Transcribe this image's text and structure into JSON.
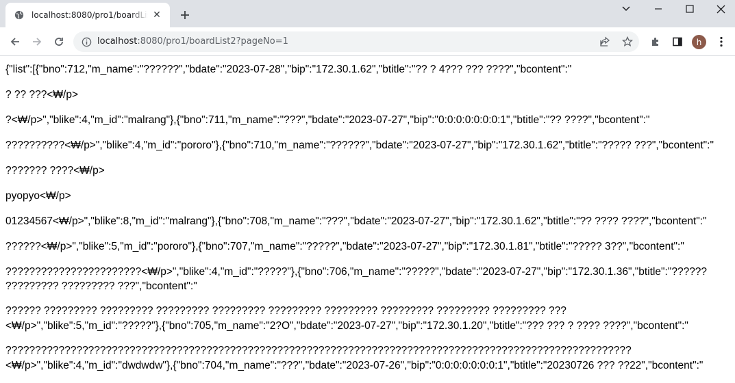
{
  "tab": {
    "title": "localhost:8080/pro1/boardList2?pageNo=1"
  },
  "address_bar": {
    "host": "localhost",
    "rest": ":8080/pro1/boardList2?pageNo=1"
  },
  "profile": {
    "initial": "h"
  },
  "content": {
    "lines": [
      "{\"list\":[{\"bno\":712,\"m_name\":\"??????\",\"bdate\":\"2023-07-28\",\"bip\":\"172.30.1.62\",\"btitle\":\"?? ? 4??? ??? ????\",\"bcontent\":\"",
      "? ?? ???<₩/p>",
      "?<₩/p>\",\"blike\":4,\"m_id\":\"malrang\"},{\"bno\":711,\"m_name\":\"???\",\"bdate\":\"2023-07-27\",\"bip\":\"0:0:0:0:0:0:0:1\",\"btitle\":\"?? ????\",\"bcontent\":\"",
      "??????????<₩/p>\",\"blike\":4,\"m_id\":\"pororo\"},{\"bno\":710,\"m_name\":\"??????\",\"bdate\":\"2023-07-27\",\"bip\":\"172.30.1.62\",\"btitle\":\"????? ???\",\"bcontent\":\"",
      "??????? ????<₩/p>",
      "pyopyo<₩/p>",
      "01234567<₩/p>\",\"blike\":8,\"m_id\":\"malrang\"},{\"bno\":708,\"m_name\":\"???\",\"bdate\":\"2023-07-27\",\"bip\":\"172.30.1.62\",\"btitle\":\"?? ???? ????\",\"bcontent\":\"",
      "??????<₩/p>\",\"blike\":5,\"m_id\":\"pororo\"},{\"bno\":707,\"m_name\":\"?????\",\"bdate\":\"2023-07-27\",\"bip\":\"172.30.1.81\",\"btitle\":\"????? 3??\",\"bcontent\":\"",
      "???????????????????????<₩/p>\",\"blike\":4,\"m_id\":\"?????\"},{\"bno\":706,\"m_name\":\"?????\",\"bdate\":\"2023-07-27\",\"bip\":\"172.30.1.36\",\"btitle\":\"??????",
      "????????? ????????? ???\",\"bcontent\":\"",
      "?????? ????????? ????????? ????????? ????????? ????????? ????????? ????????? ????????? ????????? ???",
      "<₩/p>\",\"blike\":5,\"m_id\":\"?????\"},{\"bno\":705,\"m_name\":\"2?O\",\"bdate\":\"2023-07-27\",\"bip\":\"172.30.1.20\",\"btitle\":\"??? ??? ? ???? ????\",\"bcontent\":\"",
      "??????????????????????????????????????????????????????????????????????????????????????????????????????????",
      "<₩/p>\",\"blike\":4,\"m_id\":\"dwdwdw\"},{\"bno\":704,\"m_name\":\"???\",\"bdate\":\"2023-07-26\",\"bip\":\"0:0:0:0:0:0:0:1\",\"btitle\":\"20230726 ??? ??22\",\"bcontent\":\""
    ]
  }
}
